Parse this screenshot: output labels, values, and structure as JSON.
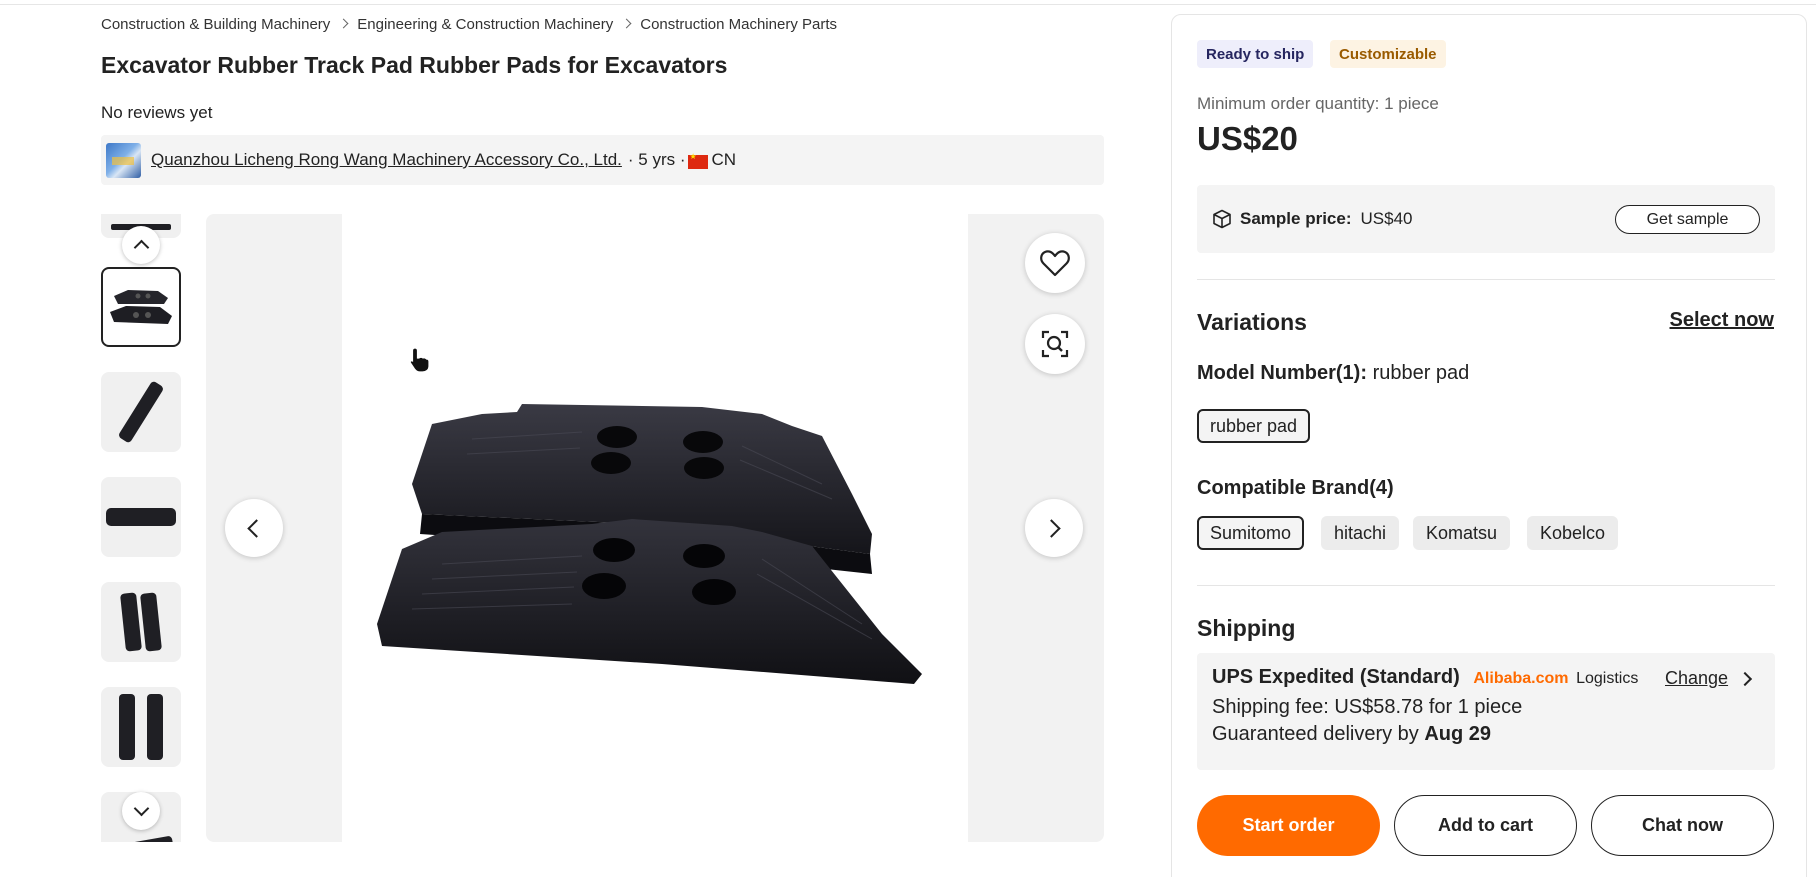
{
  "breadcrumb": [
    "Construction & Building Machinery",
    "Engineering & Construction Machinery",
    "Construction Machinery Parts"
  ],
  "product": {
    "title": "Excavator Rubber Track Pad Rubber Pads for Excavators",
    "reviews": "No reviews yet"
  },
  "supplier": {
    "name": "Quanzhou Licheng Rong Wang Machinery Accessory Co., Ltd.",
    "meta": "· 5 yrs ·",
    "country": "CN"
  },
  "gallery": {
    "active_index": 1,
    "thumb_count": 7
  },
  "panel": {
    "badges": [
      "Ready to ship",
      "Customizable"
    ],
    "moq": "Minimum order quantity: 1 piece",
    "price": "US$20",
    "sample": {
      "label": "Sample price:",
      "value": "US$40",
      "button": "Get sample"
    },
    "variations": {
      "title": "Variations",
      "select_now": "Select now",
      "model_label": "Model Number(1):",
      "model_value": "rubber pad",
      "model_options": [
        "rubber pad"
      ],
      "brand_label": "Compatible Brand(4)",
      "brand_options": [
        "Sumitomo",
        "hitachi",
        "Komatsu",
        "Kobelco"
      ]
    },
    "shipping": {
      "title": "Shipping",
      "method": "UPS Expedited (Standard)",
      "brand": "Alibaba.com",
      "brand_suffix": "Logistics",
      "change": "Change",
      "fee": "Shipping fee: US$58.78 for 1 piece",
      "delivery_prefix": "Guaranteed delivery by",
      "delivery_date": "Aug 29"
    },
    "actions": {
      "start_order": "Start order",
      "add_to_cart": "Add to cart",
      "chat_now": "Chat now"
    }
  },
  "colors": {
    "accent": "#ff6a00",
    "text": "#222222",
    "panel_bg": "#f4f4f4"
  }
}
